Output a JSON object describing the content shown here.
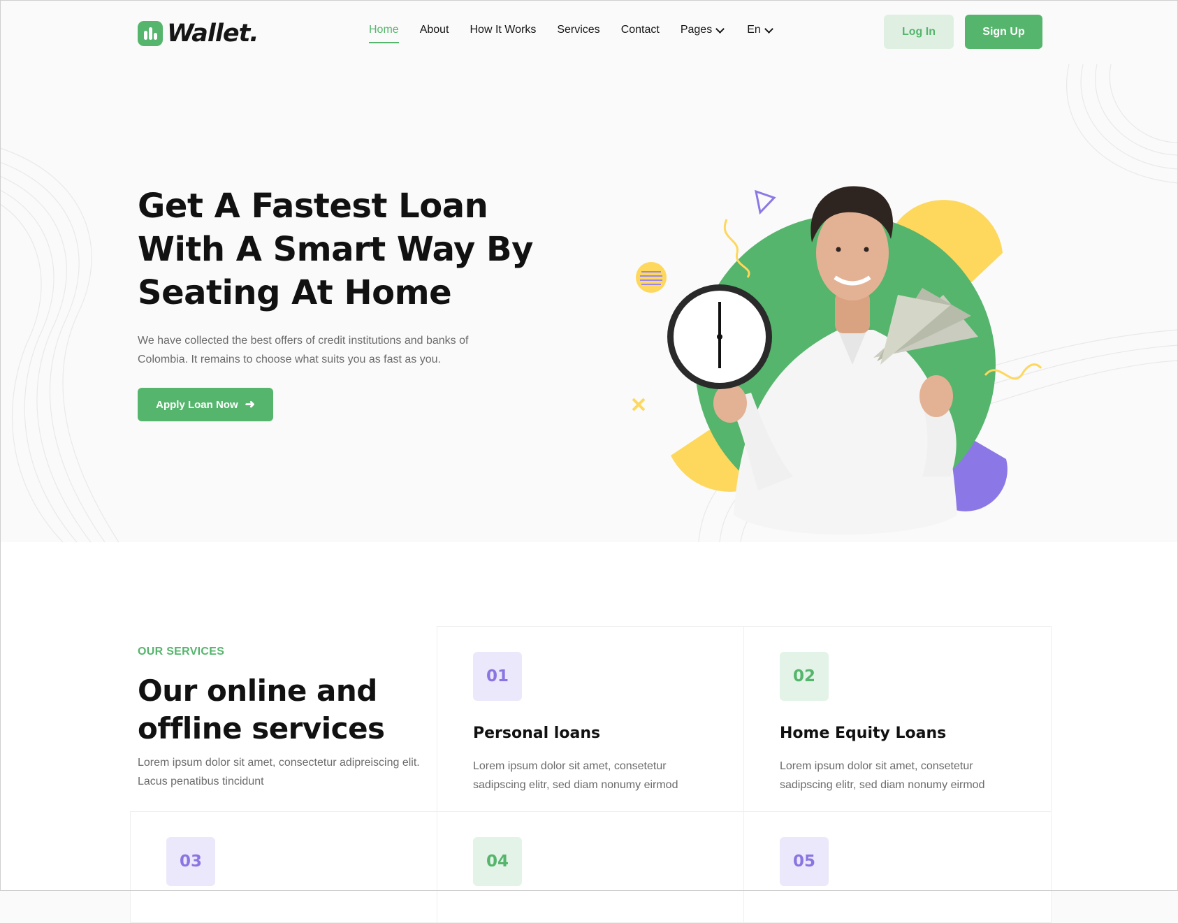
{
  "header": {
    "brand": "Wallet.",
    "nav": [
      {
        "label": "Home",
        "active": true
      },
      {
        "label": "About"
      },
      {
        "label": "How It Works"
      },
      {
        "label": "Services"
      },
      {
        "label": "Contact"
      },
      {
        "label": "Pages",
        "dropdown": true
      },
      {
        "label": "En",
        "dropdown": true
      }
    ],
    "login_label": "Log In",
    "signup_label": "Sign Up"
  },
  "hero": {
    "title": "Get A Fastest Loan With A Smart Way By Seating At Home",
    "text": "We have collected the best offers of credit institutions and banks of Colombia. It remains to choose what suits you as fast as you.",
    "cta_label": "Apply Loan Now",
    "cta_icon": "arrow-right-icon",
    "image": "man-holding-clock-and-money"
  },
  "services": {
    "kicker": "OUR SERVICES",
    "title": "Our online and offline services",
    "text": "Lorem ipsum dolor sit amet, consectetur adipreiscing elit. Lacus penatibus tincidunt",
    "cards": [
      {
        "number": "01",
        "title": "Personal loans",
        "text": "Lorem ipsum dolor sit amet, consetetur sadipscing elitr, sed diam nonumy eirmod"
      },
      {
        "number": "02",
        "title": "Home Equity Loans",
        "text": "Lorem ipsum dolor sit amet, consetetur sadipscing elitr, sed diam nonumy eirmod"
      },
      {
        "number": "03"
      },
      {
        "number": "04"
      },
      {
        "number": "05"
      }
    ]
  },
  "colors": {
    "accent": "#55b56c",
    "accent_light": "#dff0e3",
    "purple": "#8a75e2",
    "yellow": "#fdd85d"
  }
}
